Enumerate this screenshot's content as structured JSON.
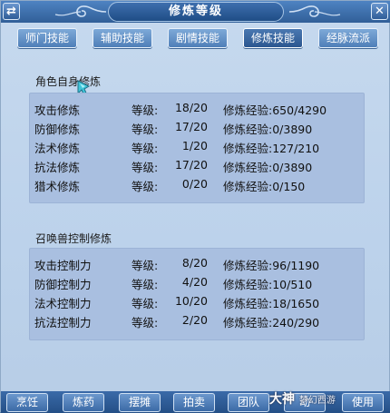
{
  "window": {
    "title": "修炼等级",
    "left_button": "⇄",
    "right_button": "✕"
  },
  "tabs": [
    {
      "label": "师门技能",
      "active": false
    },
    {
      "label": "辅助技能",
      "active": false
    },
    {
      "label": "剧情技能",
      "active": false
    },
    {
      "label": "修炼技能",
      "active": true
    },
    {
      "label": "经脉流派",
      "active": false
    }
  ],
  "role_section": {
    "title": "角色自身修炼",
    "rows": [
      {
        "name": "攻击修炼",
        "level_label": "等级:",
        "level": "18/20",
        "exp": "修炼经验:650/4290"
      },
      {
        "name": "防御修炼",
        "level_label": "等级:",
        "level": "17/20",
        "exp": "修炼经验:0/3890"
      },
      {
        "name": "法术修炼",
        "level_label": "等级:",
        "level": "1/20",
        "exp": "修炼经验:127/210"
      },
      {
        "name": "抗法修炼",
        "level_label": "等级:",
        "level": "17/20",
        "exp": "修炼经验:0/3890"
      },
      {
        "name": "猎术修炼",
        "level_label": "等级:",
        "level": "0/20",
        "exp": "修炼经验:0/150"
      }
    ]
  },
  "pet_section": {
    "title": "召唤兽控制修炼",
    "rows": [
      {
        "name": "攻击控制力",
        "level_label": "等级:",
        "level": "8/20",
        "exp": "修炼经验:96/1190"
      },
      {
        "name": "防御控制力",
        "level_label": "等级:",
        "level": "4/20",
        "exp": "修炼经验:10/510"
      },
      {
        "name": "法术控制力",
        "level_label": "等级:",
        "level": "10/20",
        "exp": "修炼经验:18/1650"
      },
      {
        "name": "抗法控制力",
        "level_label": "等级:",
        "level": "2/20",
        "exp": "修炼经验:240/290"
      }
    ]
  },
  "bottom_bar": {
    "buttons": [
      "烹饪",
      "炼药",
      "摆摊",
      "拍卖",
      "团队",
      "动",
      "使用"
    ]
  },
  "watermark": {
    "main": "大神",
    "sub": "梦幻西游"
  },
  "colors": {
    "panel_bg": "#a9bfe0",
    "window_bg": "#c6d9ee",
    "tab_active": "#2c5790",
    "tab_normal": "#6d98cb"
  }
}
